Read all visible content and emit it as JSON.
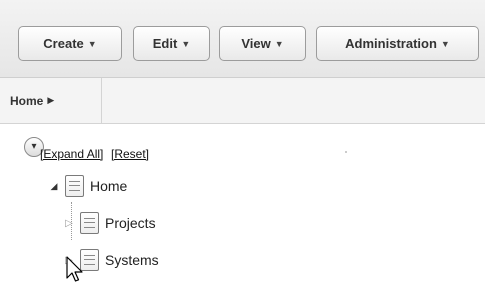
{
  "toolbar": {
    "menus": [
      {
        "label": "Create",
        "icon": "chevron-down-icon"
      },
      {
        "label": "Edit",
        "icon": "chevron-down-icon"
      },
      {
        "label": "View",
        "icon": "chevron-down-icon"
      },
      {
        "label": "Administration",
        "icon": "chevron-down-icon"
      }
    ]
  },
  "breadcrumb": {
    "items": [
      {
        "label": "Home",
        "icon": "chevron-right-icon"
      }
    ]
  },
  "tree": {
    "expand_all_label": "[Expand All]",
    "reset_label": "[Reset]",
    "nodes": [
      {
        "label": "Home",
        "expanded": true
      },
      {
        "label": "Projects",
        "expanded": false
      },
      {
        "label": "Systems",
        "expanded": false
      }
    ]
  }
}
